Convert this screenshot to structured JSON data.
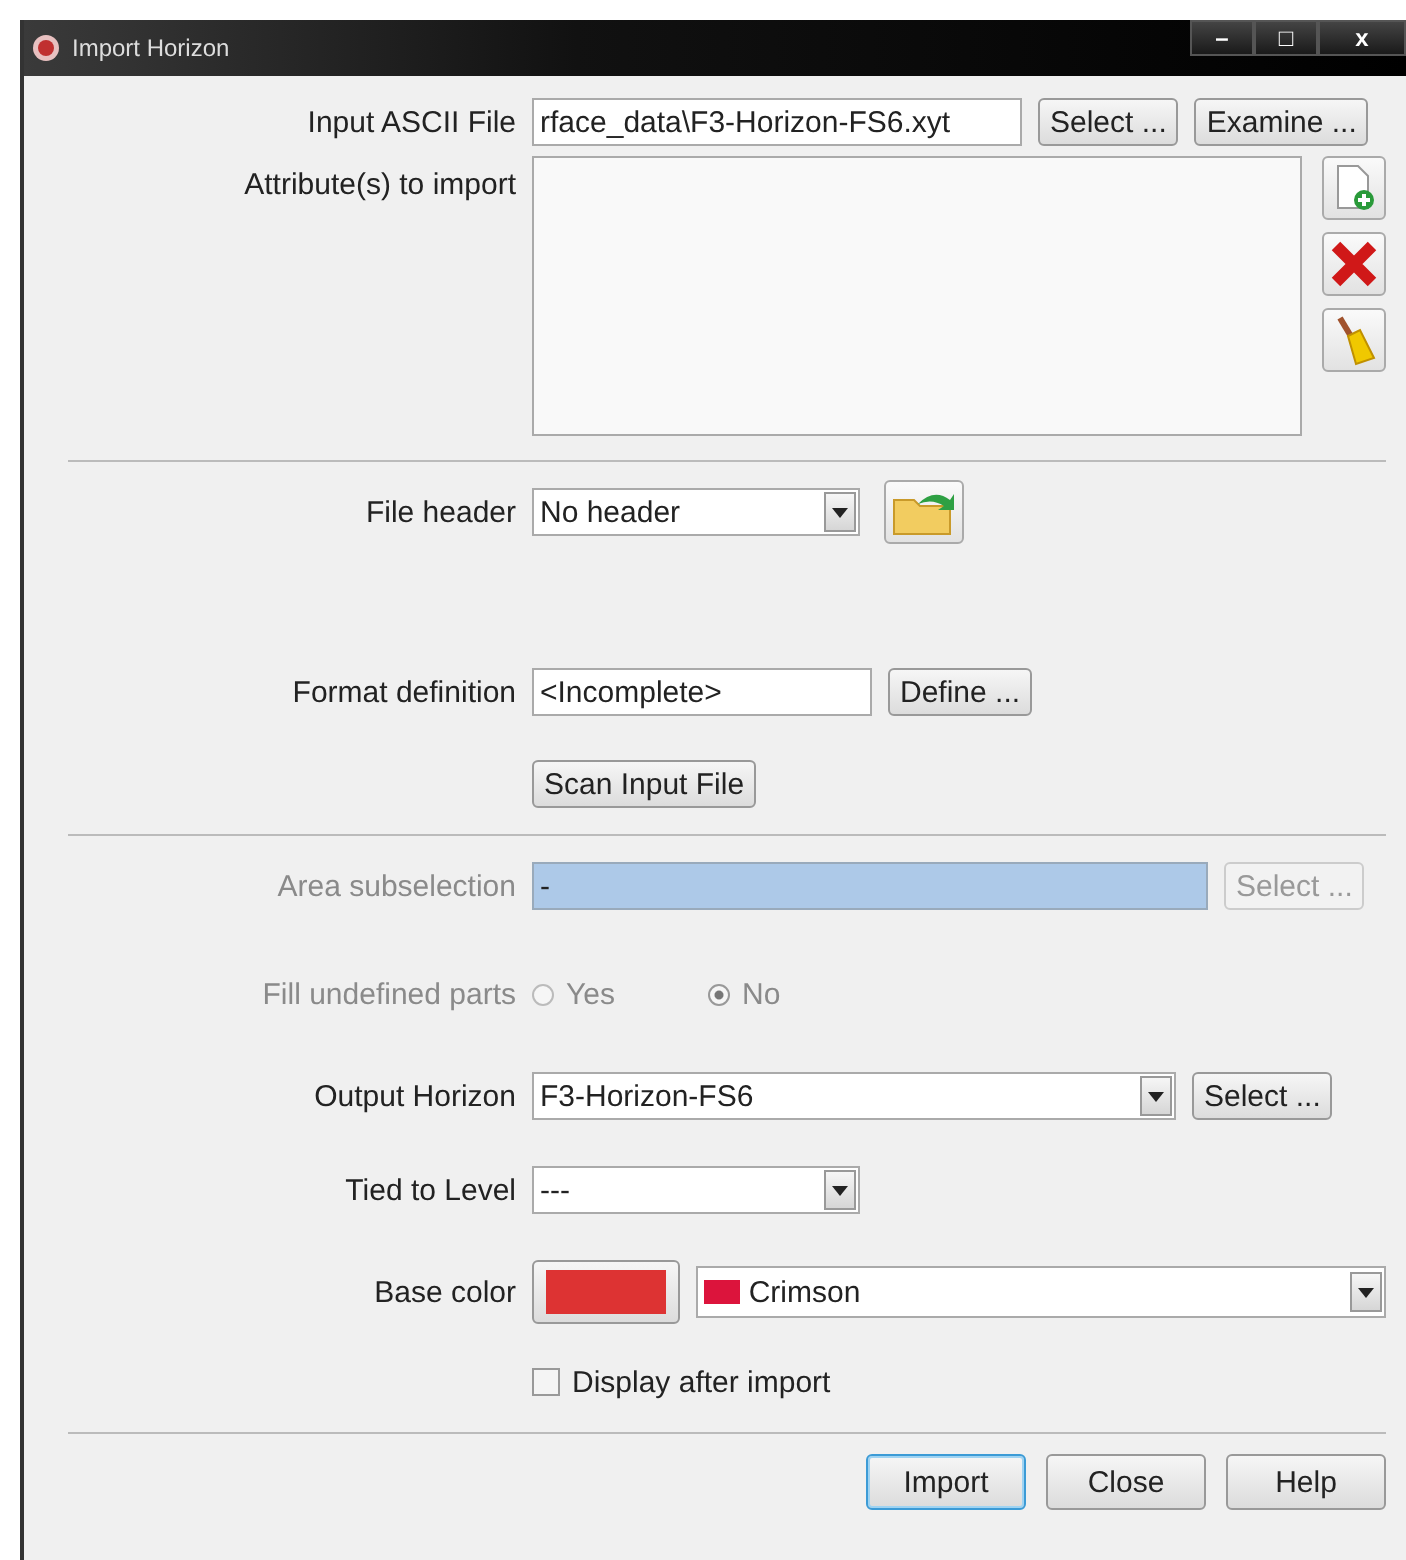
{
  "window": {
    "title": "Import Horizon",
    "controls": [
      "–",
      "□",
      "x"
    ]
  },
  "input_file": {
    "label": "Input ASCII File",
    "value": "rface_data\\F3-Horizon-FS6.xyt",
    "buttons": [
      "Select ...",
      "Examine ..."
    ]
  },
  "attributes": {
    "label": "Attribute(s) to import"
  },
  "file_header": {
    "label": "File header",
    "value": "No header"
  },
  "format_definition": {
    "label": "Format definition",
    "value": "<Incomplete>",
    "button": "Define ..."
  },
  "scan_button": "Scan Input File",
  "area_subselection": {
    "label": "Area subselection",
    "value": "-",
    "button": "Select ...",
    "disabled": true
  },
  "fill_undefined": {
    "label": "Fill undefined parts",
    "disabled": true,
    "options": [
      {
        "label": "Yes",
        "selected": false
      },
      {
        "label": "No",
        "selected": true
      }
    ]
  },
  "output_horizon": {
    "label": "Output Horizon",
    "value": "F3-Horizon-FS6",
    "button": "Select ..."
  },
  "tied_to_level": {
    "label": "Tied to Level",
    "value": "---"
  },
  "base_color": {
    "label": "Base color",
    "button": {
      "color": "#dd3333"
    },
    "choice": {
      "value": "Crimson",
      "color": "#dc143c"
    }
  },
  "display_after_import": {
    "label": "Display after import",
    "checked": false
  },
  "buttons": [
    {
      "label": "Import",
      "default": true
    },
    {
      "label": "Close",
      "default": false
    },
    {
      "label": "Help",
      "default": false
    }
  ]
}
